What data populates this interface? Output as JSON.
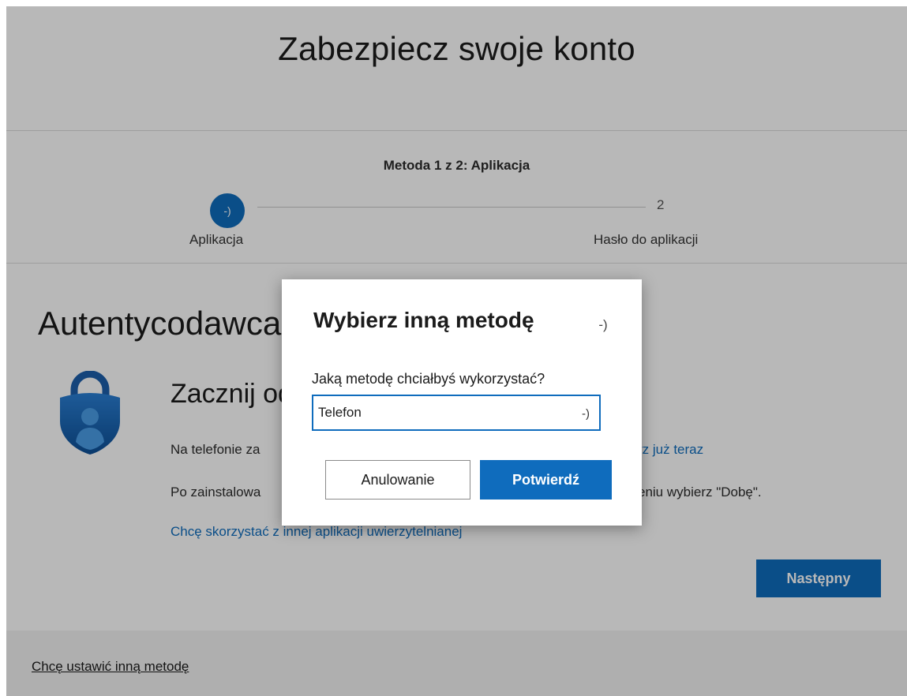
{
  "header": {
    "title": "Zabezpiecz swoje konto"
  },
  "progress": {
    "method_step": "Metoda 1 z 2: Aplikacja",
    "step1_icon_text": "-)",
    "step1_label": "Aplikacja",
    "step2_number": "2",
    "step2_label": "Hasło do aplikacji"
  },
  "main": {
    "section_title": "Autentycodawca",
    "icon": "authenticator-lock-icon",
    "sub_title": "Zacznij od",
    "para1": "Na telefonie za",
    "para2": "Po zainstalowa",
    "other_app_link": "Chcę skorzystać z innej aplikacji uwierzytelnianej",
    "download_link": "rz już teraz",
    "choose_text": "eniu wybierz \"Dobę\".",
    "next_button": "Następny"
  },
  "footer": {
    "other_method_link": "Chcę ustawić inną metodę"
  },
  "dialog": {
    "title": "Wybierz inną metodę",
    "close_text": "-)",
    "question": "Jaką metodę chciałbyś wykorzystać?",
    "selected_method": "Telefon",
    "select_chevron": "-)",
    "cancel_button": "Anulowanie",
    "confirm_button": "Potwierdź"
  },
  "colors": {
    "accent": "#0f6cbd",
    "overlay": "rgba(0,0,0,0.28)",
    "footer_bg": "#f3f3f3"
  }
}
